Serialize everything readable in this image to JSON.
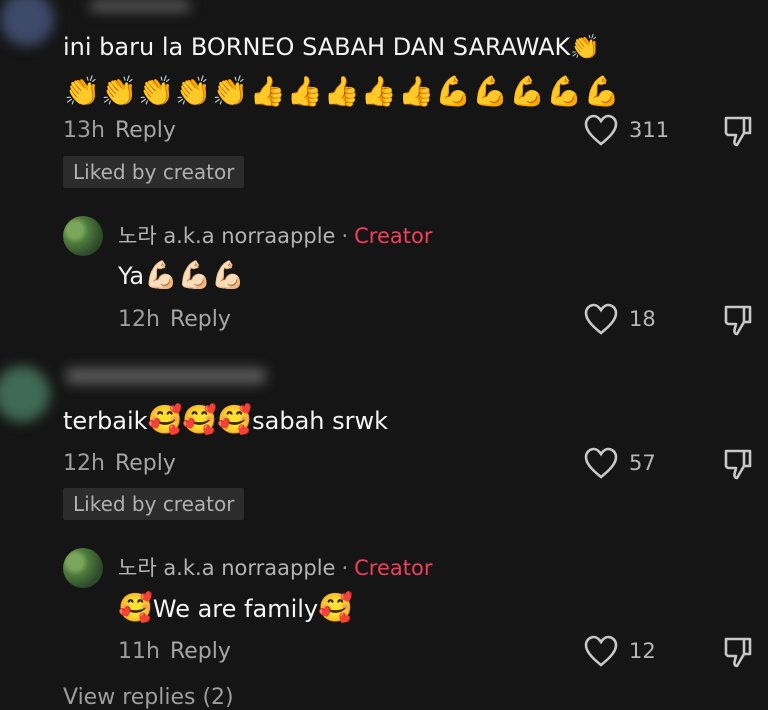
{
  "comments": [
    {
      "text": "ini baru la BORNEO SABAH DAN SARAWAK",
      "emoji_trail": "👏",
      "emoji_line": "👏👏👏👏👏👍👍👍👍👍💪💪💪💪💪",
      "time": "13h",
      "reply_label": "Reply",
      "likes": "311",
      "liked_by": "Liked by creator",
      "reply": {
        "name": "노라 a.k.a norraapple",
        "dot": "·",
        "creator_label": "Creator",
        "text_prefix": "Ya",
        "emojis": "💪🏻💪🏻💪🏻",
        "time": "12h",
        "reply_label": "Reply",
        "likes": "18"
      }
    },
    {
      "text": "terbaik",
      "emojis": "🥰🥰🥰",
      "text_suffix": "sabah srwk",
      "time": "12h",
      "reply_label": "Reply",
      "likes": "57",
      "liked_by": "Liked by creator",
      "reply": {
        "name": "노라 a.k.a norraapple",
        "dot": "·",
        "creator_label": "Creator",
        "emoji_before": "🥰",
        "text": "We are family",
        "emoji_after": "🥰",
        "time": "11h",
        "reply_label": "Reply",
        "likes": "12"
      }
    }
  ],
  "footer": {
    "view_replies": "View replies (2)"
  },
  "icons": {
    "heart": "heart-outline-icon",
    "dislike": "thumbs-down-icon"
  },
  "colors": {
    "background": "#151515",
    "creator": "#ef3f5c",
    "muted": "#9d9d9d"
  }
}
